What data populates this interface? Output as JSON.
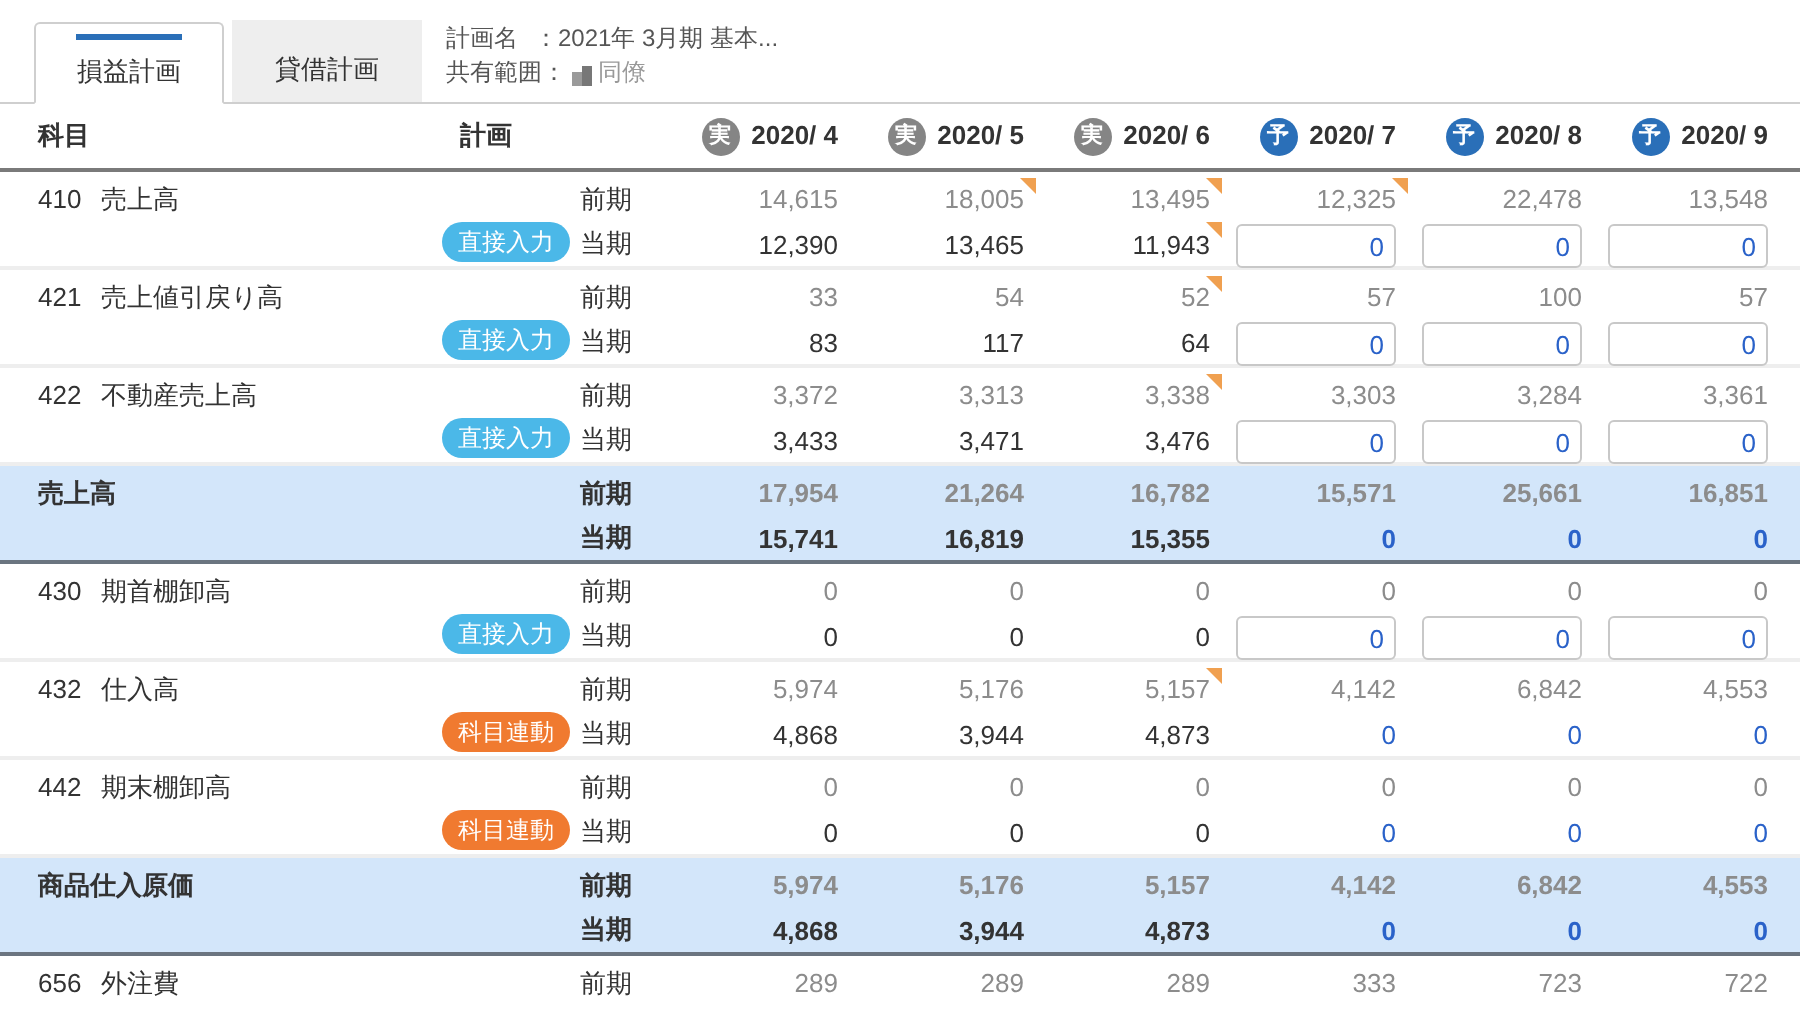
{
  "tabs": [
    {
      "label": "損益計画",
      "selected": true
    },
    {
      "label": "貸借計画",
      "selected": false
    }
  ],
  "plan_info": {
    "name_label": "計画名",
    "name_value": "：2021年 3月期 基本...",
    "scope_label": "共有範囲：",
    "scope_value": "同僚"
  },
  "table": {
    "columns": [
      {
        "label": "科目"
      },
      {
        "label": "計画"
      }
    ],
    "months": [
      {
        "label": "2020/ 4",
        "kind": "actual",
        "mark": "実"
      },
      {
        "label": "2020/ 5",
        "kind": "actual",
        "mark": "実"
      },
      {
        "label": "2020/ 6",
        "kind": "actual",
        "mark": "実"
      },
      {
        "label": "2020/ 7",
        "kind": "forecast",
        "mark": "予"
      },
      {
        "label": "2020/ 8",
        "kind": "forecast",
        "mark": "予"
      },
      {
        "label": "2020/ 9",
        "kind": "forecast",
        "mark": "予"
      }
    ],
    "rows": [
      {
        "kind": "account",
        "code": "410",
        "name": "売上高",
        "badge": {
          "label": "直接入力",
          "kind": "direct"
        },
        "prev_label": "前期",
        "prev": [
          "14,615",
          "18,005",
          "13,495",
          "12,325",
          "22,478",
          "13,548"
        ],
        "prev_flags": [
          false,
          true,
          true,
          true,
          false,
          false
        ],
        "curr_label": "当期",
        "curr": [
          "12,390",
          "13,465",
          "11,943",
          "0",
          "0",
          "0"
        ],
        "curr_flags": [
          false,
          false,
          true,
          false,
          false,
          false
        ]
      },
      {
        "kind": "account",
        "code": "421",
        "name": "売上値引戻り高",
        "badge": {
          "label": "直接入力",
          "kind": "direct"
        },
        "prev_label": "前期",
        "prev": [
          "33",
          "54",
          "52",
          "57",
          "100",
          "57"
        ],
        "prev_flags": [
          false,
          false,
          true,
          false,
          false,
          false
        ],
        "curr_label": "当期",
        "curr": [
          "83",
          "117",
          "64",
          "0",
          "0",
          "0"
        ],
        "curr_flags": [
          false,
          false,
          false,
          false,
          false,
          false
        ]
      },
      {
        "kind": "account",
        "code": "422",
        "name": "不動産売上高",
        "badge": {
          "label": "直接入力",
          "kind": "direct"
        },
        "prev_label": "前期",
        "prev": [
          "3,372",
          "3,313",
          "3,338",
          "3,303",
          "3,284",
          "3,361"
        ],
        "prev_flags": [
          false,
          false,
          true,
          false,
          false,
          false
        ],
        "curr_label": "当期",
        "curr": [
          "3,433",
          "3,471",
          "3,476",
          "0",
          "0",
          "0"
        ],
        "curr_flags": [
          false,
          false,
          false,
          false,
          false,
          false
        ]
      },
      {
        "kind": "total",
        "name": "売上高",
        "prev_label": "前期",
        "prev": [
          "17,954",
          "21,264",
          "16,782",
          "15,571",
          "25,661",
          "16,851"
        ],
        "prev_flags": [
          false,
          false,
          false,
          false,
          false,
          false
        ],
        "curr_label": "当期",
        "curr": [
          "15,741",
          "16,819",
          "15,355",
          "0",
          "0",
          "0"
        ],
        "curr_flags": [
          false,
          false,
          false,
          false,
          false,
          false
        ]
      },
      {
        "kind": "account",
        "code": "430",
        "name": "期首棚卸高",
        "badge": {
          "label": "直接入力",
          "kind": "direct"
        },
        "prev_label": "前期",
        "prev": [
          "0",
          "0",
          "0",
          "0",
          "0",
          "0"
        ],
        "prev_flags": [
          false,
          false,
          false,
          false,
          false,
          false
        ],
        "curr_label": "当期",
        "curr": [
          "0",
          "0",
          "0",
          "0",
          "0",
          "0"
        ],
        "curr_flags": [
          false,
          false,
          false,
          false,
          false,
          false
        ]
      },
      {
        "kind": "account",
        "code": "432",
        "name": "仕入高",
        "badge": {
          "label": "科目連動",
          "kind": "linked"
        },
        "prev_label": "前期",
        "prev": [
          "5,974",
          "5,176",
          "5,157",
          "4,142",
          "6,842",
          "4,553"
        ],
        "prev_flags": [
          false,
          false,
          true,
          false,
          false,
          false
        ],
        "curr_label": "当期",
        "curr": [
          "4,868",
          "3,944",
          "4,873",
          "0",
          "0",
          "0"
        ],
        "curr_flags": [
          false,
          false,
          false,
          false,
          false,
          false
        ]
      },
      {
        "kind": "account",
        "code": "442",
        "name": "期末棚卸高",
        "badge": {
          "label": "科目連動",
          "kind": "linked"
        },
        "prev_label": "前期",
        "prev": [
          "0",
          "0",
          "0",
          "0",
          "0",
          "0"
        ],
        "prev_flags": [
          false,
          false,
          false,
          false,
          false,
          false
        ],
        "curr_label": "当期",
        "curr": [
          "0",
          "0",
          "0",
          "0",
          "0",
          "0"
        ],
        "curr_flags": [
          false,
          false,
          false,
          false,
          false,
          false
        ]
      },
      {
        "kind": "total",
        "name": "商品仕入原価",
        "prev_label": "前期",
        "prev": [
          "5,974",
          "5,176",
          "5,157",
          "4,142",
          "6,842",
          "4,553"
        ],
        "prev_flags": [
          false,
          false,
          false,
          false,
          false,
          false
        ],
        "curr_label": "当期",
        "curr": [
          "4,868",
          "3,944",
          "4,873",
          "0",
          "0",
          "0"
        ],
        "curr_flags": [
          false,
          false,
          false,
          false,
          false,
          false
        ]
      },
      {
        "kind": "account",
        "code": "656",
        "name": "外注費",
        "prev_label": "前期",
        "prev": [
          "289",
          "289",
          "289",
          "333",
          "723",
          "722"
        ],
        "prev_flags": [
          false,
          false,
          false,
          false,
          false,
          false
        ]
      }
    ]
  }
}
